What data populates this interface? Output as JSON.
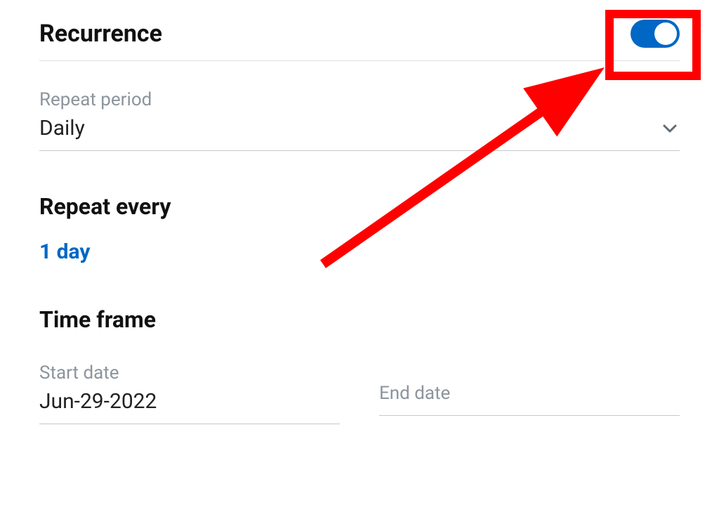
{
  "recurrence": {
    "title": "Recurrence",
    "enabled": true
  },
  "repeatPeriod": {
    "label": "Repeat period",
    "value": "Daily"
  },
  "repeatEvery": {
    "heading": "Repeat every",
    "value": "1 day"
  },
  "timeFrame": {
    "heading": "Time frame",
    "startDate": {
      "label": "Start date",
      "value": "Jun-29-2022"
    },
    "endDate": {
      "label": "End date",
      "value": ""
    }
  },
  "colors": {
    "accent": "#0067c5",
    "annotation": "#ff0000"
  }
}
